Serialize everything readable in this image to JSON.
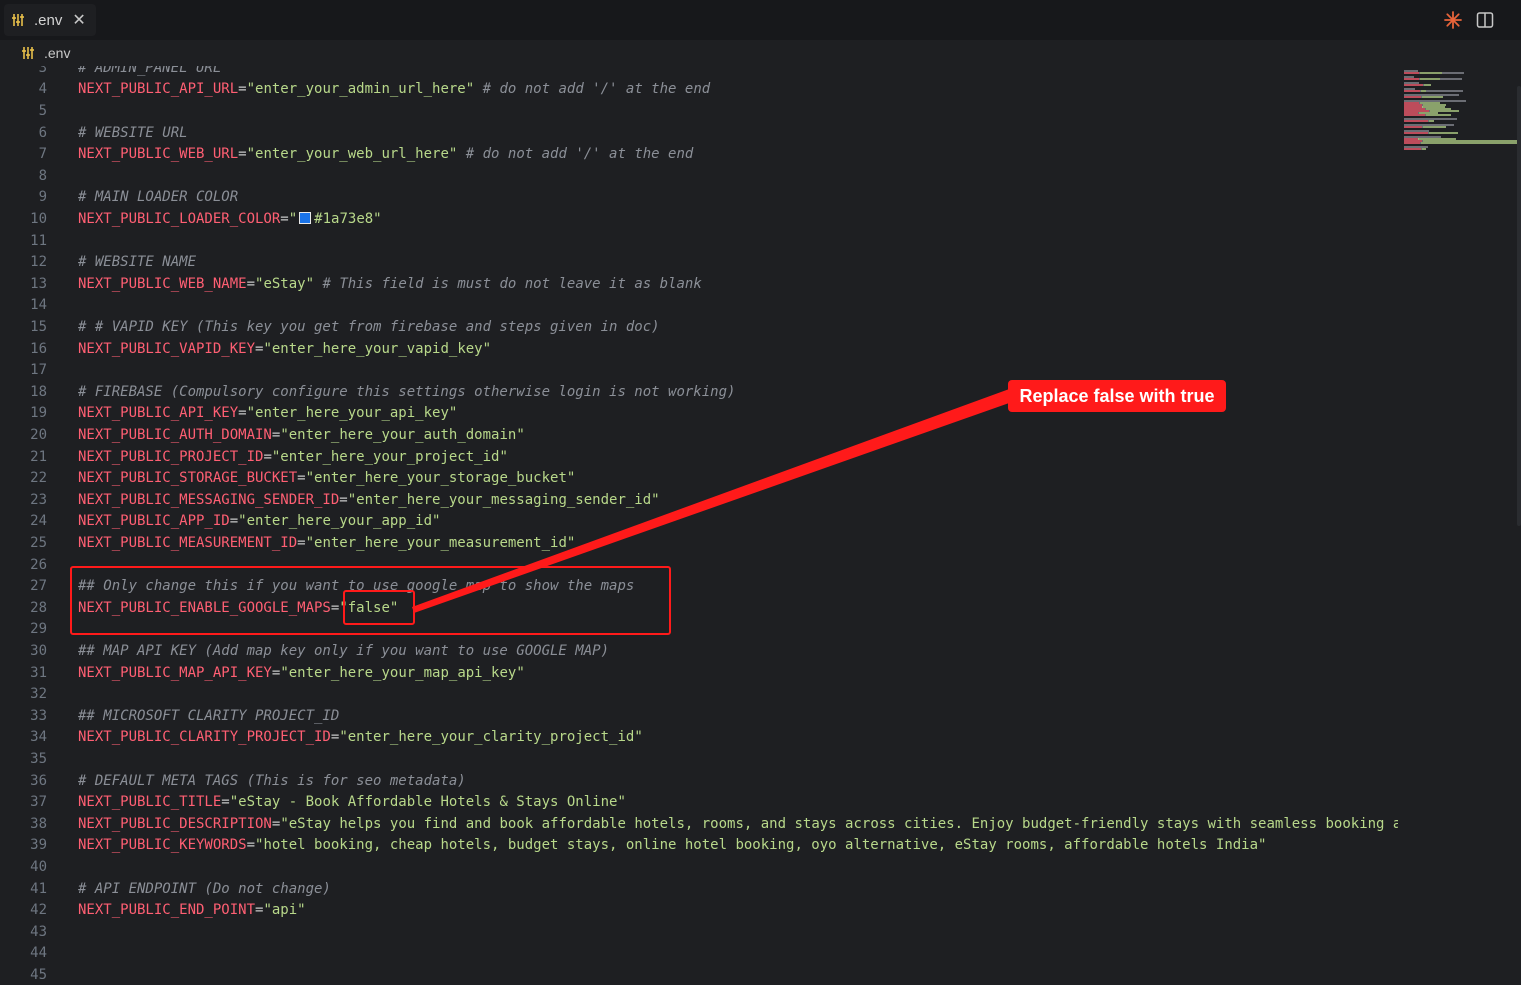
{
  "tab": {
    "filename": ".env",
    "close": "✕"
  },
  "breadcrumb": {
    "filename": ".env"
  },
  "icons": {
    "file": "env-file-icon",
    "close": "close-icon",
    "sparkle": "sparkle-icon",
    "split": "split-editor-icon"
  },
  "colors": {
    "keyword": "#ff5f73",
    "string": "#b8d88a",
    "comment": "#8b8f97",
    "annotation": "#ff1a1a",
    "swatch": "#1a73e8"
  },
  "lines": [
    {
      "n": "3",
      "parts": [
        {
          "t": "c",
          "v": "# ADMIN_PANEL URL"
        }
      ]
    },
    {
      "n": "4",
      "parts": [
        {
          "t": "k",
          "v": "NEXT_PUBLIC_API_URL"
        },
        {
          "t": "eq",
          "v": "="
        },
        {
          "t": "s",
          "v": "\"enter_your_admin_url_here\""
        },
        {
          "t": "c",
          "v": " # do not add '/' at the end"
        }
      ]
    },
    {
      "n": "5",
      "parts": []
    },
    {
      "n": "6",
      "parts": [
        {
          "t": "c",
          "v": "# WEBSITE URL"
        }
      ]
    },
    {
      "n": "7",
      "parts": [
        {
          "t": "k",
          "v": "NEXT_PUBLIC_WEB_URL"
        },
        {
          "t": "eq",
          "v": "="
        },
        {
          "t": "s",
          "v": "\"enter_your_web_url_here\""
        },
        {
          "t": "c",
          "v": " # do not add '/' at the end"
        }
      ]
    },
    {
      "n": "8",
      "parts": []
    },
    {
      "n": "9",
      "parts": [
        {
          "t": "c",
          "v": "# MAIN LOADER COLOR"
        }
      ]
    },
    {
      "n": "10",
      "parts": [
        {
          "t": "k",
          "v": "NEXT_PUBLIC_LOADER_COLOR"
        },
        {
          "t": "eq",
          "v": "="
        },
        {
          "t": "s",
          "v": "\""
        },
        {
          "t": "sw",
          "v": ""
        },
        {
          "t": "s",
          "v": "#1a73e8\""
        }
      ]
    },
    {
      "n": "11",
      "parts": []
    },
    {
      "n": "12",
      "parts": [
        {
          "t": "c",
          "v": "# WEBSITE NAME"
        }
      ]
    },
    {
      "n": "13",
      "parts": [
        {
          "t": "k",
          "v": "NEXT_PUBLIC_WEB_NAME"
        },
        {
          "t": "eq",
          "v": "="
        },
        {
          "t": "s",
          "v": "\"eStay\""
        },
        {
          "t": "c",
          "v": " # This field is must do not leave it as blank"
        }
      ]
    },
    {
      "n": "14",
      "parts": []
    },
    {
      "n": "15",
      "parts": [
        {
          "t": "c",
          "v": "# # VAPID KEY (This key you get from firebase and steps given in doc)"
        }
      ]
    },
    {
      "n": "16",
      "parts": [
        {
          "t": "k",
          "v": "NEXT_PUBLIC_VAPID_KEY"
        },
        {
          "t": "eq",
          "v": "="
        },
        {
          "t": "s",
          "v": "\"enter_here_your_vapid_key\""
        }
      ]
    },
    {
      "n": "17",
      "parts": []
    },
    {
      "n": "18",
      "parts": [
        {
          "t": "c",
          "v": "# FIREBASE (Compulsory configure this settings otherwise login is not working)"
        }
      ]
    },
    {
      "n": "19",
      "parts": [
        {
          "t": "k",
          "v": "NEXT_PUBLIC_API_KEY"
        },
        {
          "t": "eq",
          "v": "="
        },
        {
          "t": "s",
          "v": "\"enter_here_your_api_key\""
        }
      ]
    },
    {
      "n": "20",
      "parts": [
        {
          "t": "k",
          "v": "NEXT_PUBLIC_AUTH_DOMAIN"
        },
        {
          "t": "eq",
          "v": "="
        },
        {
          "t": "s",
          "v": "\"enter_here_your_auth_domain\""
        }
      ]
    },
    {
      "n": "21",
      "parts": [
        {
          "t": "k",
          "v": "NEXT_PUBLIC_PROJECT_ID"
        },
        {
          "t": "eq",
          "v": "="
        },
        {
          "t": "s",
          "v": "\"enter_here_your_project_id\""
        }
      ]
    },
    {
      "n": "22",
      "parts": [
        {
          "t": "k",
          "v": "NEXT_PUBLIC_STORAGE_BUCKET"
        },
        {
          "t": "eq",
          "v": "="
        },
        {
          "t": "s",
          "v": "\"enter_here_your_storage_bucket\""
        }
      ]
    },
    {
      "n": "23",
      "parts": [
        {
          "t": "k",
          "v": "NEXT_PUBLIC_MESSAGING_SENDER_ID"
        },
        {
          "t": "eq",
          "v": "="
        },
        {
          "t": "s",
          "v": "\"enter_here_your_messaging_sender_id\""
        }
      ]
    },
    {
      "n": "24",
      "parts": [
        {
          "t": "k",
          "v": "NEXT_PUBLIC_APP_ID"
        },
        {
          "t": "eq",
          "v": "="
        },
        {
          "t": "s",
          "v": "\"enter_here_your_app_id\""
        }
      ]
    },
    {
      "n": "25",
      "parts": [
        {
          "t": "k",
          "v": "NEXT_PUBLIC_MEASUREMENT_ID"
        },
        {
          "t": "eq",
          "v": "="
        },
        {
          "t": "s",
          "v": "\"enter_here_your_measurement_id\""
        }
      ]
    },
    {
      "n": "26",
      "parts": []
    },
    {
      "n": "27",
      "parts": [
        {
          "t": "c",
          "v": "## Only change this if you want to use google map to show the maps"
        }
      ]
    },
    {
      "n": "28",
      "parts": [
        {
          "t": "k",
          "v": "NEXT_PUBLIC_ENABLE_GOOGLE_MAPS"
        },
        {
          "t": "eq",
          "v": "="
        },
        {
          "t": "s",
          "v": "\"false\""
        }
      ]
    },
    {
      "n": "29",
      "parts": []
    },
    {
      "n": "30",
      "parts": [
        {
          "t": "c",
          "v": "## MAP API KEY (Add map key only if you want to use GOOGLE MAP)"
        }
      ]
    },
    {
      "n": "31",
      "parts": [
        {
          "t": "k",
          "v": "NEXT_PUBLIC_MAP_API_KEY"
        },
        {
          "t": "eq",
          "v": "="
        },
        {
          "t": "s",
          "v": "\"enter_here_your_map_api_key\""
        }
      ]
    },
    {
      "n": "32",
      "parts": []
    },
    {
      "n": "33",
      "parts": [
        {
          "t": "c",
          "v": "## MICROSOFT CLARITY PROJECT_ID"
        }
      ]
    },
    {
      "n": "34",
      "parts": [
        {
          "t": "k",
          "v": "NEXT_PUBLIC_CLARITY_PROJECT_ID"
        },
        {
          "t": "eq",
          "v": "="
        },
        {
          "t": "s",
          "v": "\"enter_here_your_clarity_project_id\""
        }
      ]
    },
    {
      "n": "35",
      "parts": []
    },
    {
      "n": "36",
      "parts": [
        {
          "t": "c",
          "v": "# DEFAULT META TAGS (This is for seo metadata)"
        }
      ]
    },
    {
      "n": "37",
      "parts": [
        {
          "t": "k",
          "v": "NEXT_PUBLIC_TITLE"
        },
        {
          "t": "eq",
          "v": "="
        },
        {
          "t": "s",
          "v": "\"eStay - Book Affordable Hotels & Stays Online\""
        }
      ]
    },
    {
      "n": "38",
      "parts": [
        {
          "t": "k",
          "v": "NEXT_PUBLIC_DESCRIPTION"
        },
        {
          "t": "eq",
          "v": "="
        },
        {
          "t": "s",
          "v": "\"eStay helps you find and book affordable hotels, rooms, and stays across cities. Enjoy budget-friendly stays with seamless booking and best d"
        }
      ]
    },
    {
      "n": "39",
      "parts": [
        {
          "t": "k",
          "v": "NEXT_PUBLIC_KEYWORDS"
        },
        {
          "t": "eq",
          "v": "="
        },
        {
          "t": "s",
          "v": "\"hotel booking, cheap hotels, budget stays, online hotel booking, oyo alternative, eStay rooms, affordable hotels India\""
        }
      ]
    },
    {
      "n": "40",
      "parts": []
    },
    {
      "n": "41",
      "parts": [
        {
          "t": "c",
          "v": "# API ENDPOINT (Do not change)"
        }
      ]
    },
    {
      "n": "42",
      "parts": [
        {
          "t": "k",
          "v": "NEXT_PUBLIC_END_POINT"
        },
        {
          "t": "eq",
          "v": "="
        },
        {
          "t": "s",
          "v": "\"api\""
        }
      ]
    },
    {
      "n": "43",
      "parts": []
    },
    {
      "n": "44",
      "parts": []
    },
    {
      "n": "45",
      "parts": []
    }
  ],
  "annotation": {
    "text": "Replace false with true"
  }
}
